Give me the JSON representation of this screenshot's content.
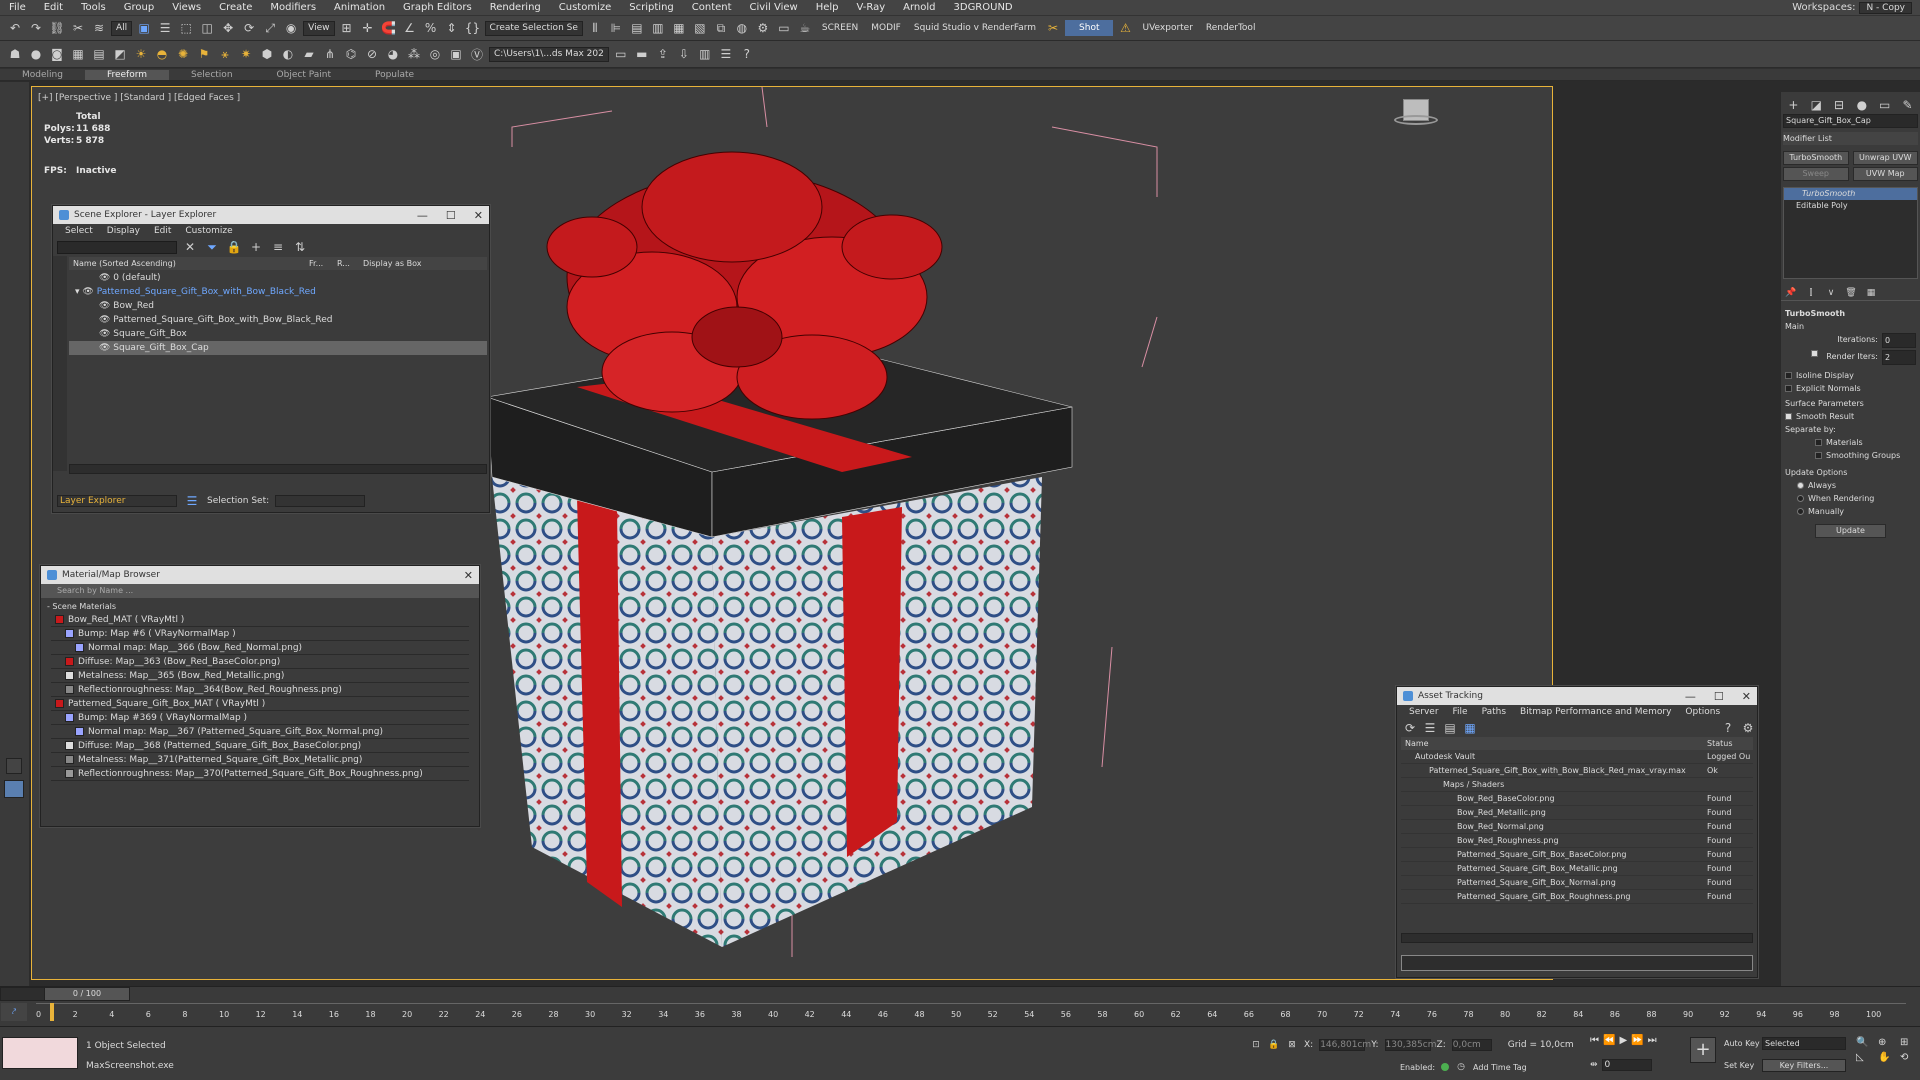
{
  "menubar": {
    "items": [
      "File",
      "Edit",
      "Tools",
      "Group",
      "Views",
      "Create",
      "Modifiers",
      "Animation",
      "Graph Editors",
      "Rendering",
      "Customize",
      "Scripting",
      "Content",
      "Civil View",
      "Help",
      "V-Ray",
      "Arnold",
      "3DGROUND"
    ],
    "workspaces_label": "Workspaces:",
    "workspace_value": "N - Copy"
  },
  "toolbar": {
    "filter_select": "All",
    "view_select": "View",
    "selection_set": "Create Selection Se",
    "screen_label": "SCREEN",
    "modif_label": "MODIF",
    "squid_label": "Squid Studio v",
    "renderfarm_label": "RenderFarm",
    "shot_label": "Shot",
    "uvexporter_label": "UVexporter",
    "rendertool_label": "RenderTool",
    "path_select": "C:\\Users\\1\\...ds Max 202"
  },
  "ribbon": {
    "tabs": [
      "Modeling",
      "Freeform",
      "Selection",
      "Object Paint",
      "Populate"
    ],
    "active": "Freeform"
  },
  "viewport": {
    "label": "[+] [Perspective ] [Standard ] [Edged Faces ]",
    "stats_total": "Total",
    "polys_label": "Polys:",
    "polys_value": "11 688",
    "verts_label": "Verts:",
    "verts_value": "5 878",
    "fps_label": "FPS:",
    "fps_value": "Inactive",
    "colors": {
      "bow": "#c8191b",
      "box_dark": "#1e1e1e",
      "pattern": "#cfd3dc",
      "wire": "#d98fa4"
    }
  },
  "scene_explorer": {
    "title": "Scene Explorer - Layer Explorer",
    "menu": [
      "Select",
      "Display",
      "Edit",
      "Customize"
    ],
    "col_name": "Name (Sorted Ascending)",
    "col_fr": "Fr...",
    "col_r": "R...",
    "col_display": "Display as Box",
    "rows": [
      "0 (default)",
      "Patterned_Square_Gift_Box_with_Bow_Black_Red",
      "Bow_Red",
      "Patterned_Square_Gift_Box_with_Bow_Black_Red",
      "Square_Gift_Box",
      "Square_Gift_Box_Cap"
    ],
    "footer_layer": "Layer Explorer",
    "footer_selset": "Selection Set:"
  },
  "material_browser": {
    "title": "Material/Map Browser",
    "search_placeholder": "Search by Name ...",
    "group": "- Scene Materials",
    "rows": [
      "Bow_Red_MAT ( VRayMtl )",
      "Bump: Map #6 ( VRayNormalMap )",
      "Normal map: Map__366 (Bow_Red_Normal.png)",
      "Diffuse: Map__363 (Bow_Red_BaseColor.png)",
      "Metalness: Map__365 (Bow_Red_Metallic.png)",
      "Reflectionroughness: Map__364(Bow_Red_Roughness.png)",
      "Patterned_Square_Gift_Box_MAT ( VRayMtl )",
      "Bump: Map #369 ( VRayNormalMap )",
      "Normal map: Map__367 (Patterned_Square_Gift_Box_Normal.png)",
      "Diffuse: Map__368 (Patterned_Square_Gift_Box_BaseColor.png)",
      "Metalness: Map__371(Patterned_Square_Gift_Box_Metallic.png)",
      "Reflectionroughness: Map__370(Patterned_Square_Gift_Box_Roughness.png)"
    ]
  },
  "asset_tracking": {
    "title": "Asset Tracking",
    "menu": [
      "Server",
      "File",
      "Paths",
      "Bitmap Performance and Memory",
      "Options"
    ],
    "col_name": "Name",
    "col_status": "Status",
    "rows": [
      {
        "name": "Autodesk Vault",
        "status": "Logged Ou"
      },
      {
        "name": "Patterned_Square_Gift_Box_with_Bow_Black_Red_max_vray.max",
        "status": "Ok"
      },
      {
        "name": "Maps / Shaders",
        "status": ""
      },
      {
        "name": "Bow_Red_BaseColor.png",
        "status": "Found"
      },
      {
        "name": "Bow_Red_Metallic.png",
        "status": "Found"
      },
      {
        "name": "Bow_Red_Normal.png",
        "status": "Found"
      },
      {
        "name": "Bow_Red_Roughness.png",
        "status": "Found"
      },
      {
        "name": "Patterned_Square_Gift_Box_BaseColor.png",
        "status": "Found"
      },
      {
        "name": "Patterned_Square_Gift_Box_Metallic.png",
        "status": "Found"
      },
      {
        "name": "Patterned_Square_Gift_Box_Normal.png",
        "status": "Found"
      },
      {
        "name": "Patterned_Square_Gift_Box_Roughness.png",
        "status": "Found"
      }
    ]
  },
  "command_panel": {
    "object_name": "Square_Gift_Box_Cap",
    "modifier_list": "Modifier List",
    "btn_turbosmooth": "TurboSmooth",
    "btn_unwrap": "Unwrap UVW",
    "btn_sweep": "Sweep",
    "btn_uvwmap": "UVW Map",
    "stack": [
      "TurboSmooth",
      "Editable Poly"
    ],
    "rollout_title": "TurboSmooth",
    "main": "Main",
    "iterations_label": "Iterations:",
    "iterations_value": "0",
    "render_iters_label": "Render Iters:",
    "render_iters_value": "2",
    "isoline": "Isoline Display",
    "explicit_normals": "Explicit Normals",
    "surface_params": "Surface Parameters",
    "smooth_result": "Smooth Result",
    "separate_by": "Separate by:",
    "materials": "Materials",
    "smoothing_groups": "Smoothing Groups",
    "update_options": "Update Options",
    "always": "Always",
    "when_rendering": "When Rendering",
    "manually": "Manually",
    "update_btn": "Update"
  },
  "timeline": {
    "frame_range": "0 / 100",
    "ticks": [
      "0",
      "2",
      "4",
      "6",
      "8",
      "10",
      "12",
      "14",
      "16",
      "18",
      "20",
      "22",
      "24",
      "26",
      "28",
      "30",
      "32",
      "34",
      "36",
      "38",
      "40",
      "42",
      "44",
      "46",
      "48",
      "50",
      "52",
      "54",
      "56",
      "58",
      "60",
      "62",
      "64",
      "66",
      "68",
      "70",
      "72",
      "74",
      "76",
      "78",
      "80",
      "82",
      "84",
      "86",
      "88",
      "90",
      "92",
      "94",
      "96",
      "98",
      "100"
    ]
  },
  "status": {
    "selected": "1 Object Selected",
    "script_file": "MaxScreenshot.exe",
    "x_label": "X:",
    "x_value": "146,801cm",
    "y_label": "Y:",
    "y_value": "130,385cm",
    "z_label": "Z:",
    "z_value": "0,0cm",
    "grid": "Grid = 10,0cm",
    "enabled": "Enabled:",
    "add_time_tag": "Add Time Tag",
    "auto_key": "Auto Key",
    "selected_dd": "Selected",
    "set_key": "Set Key",
    "key_filters": "Key Filters...",
    "frame": "0"
  }
}
